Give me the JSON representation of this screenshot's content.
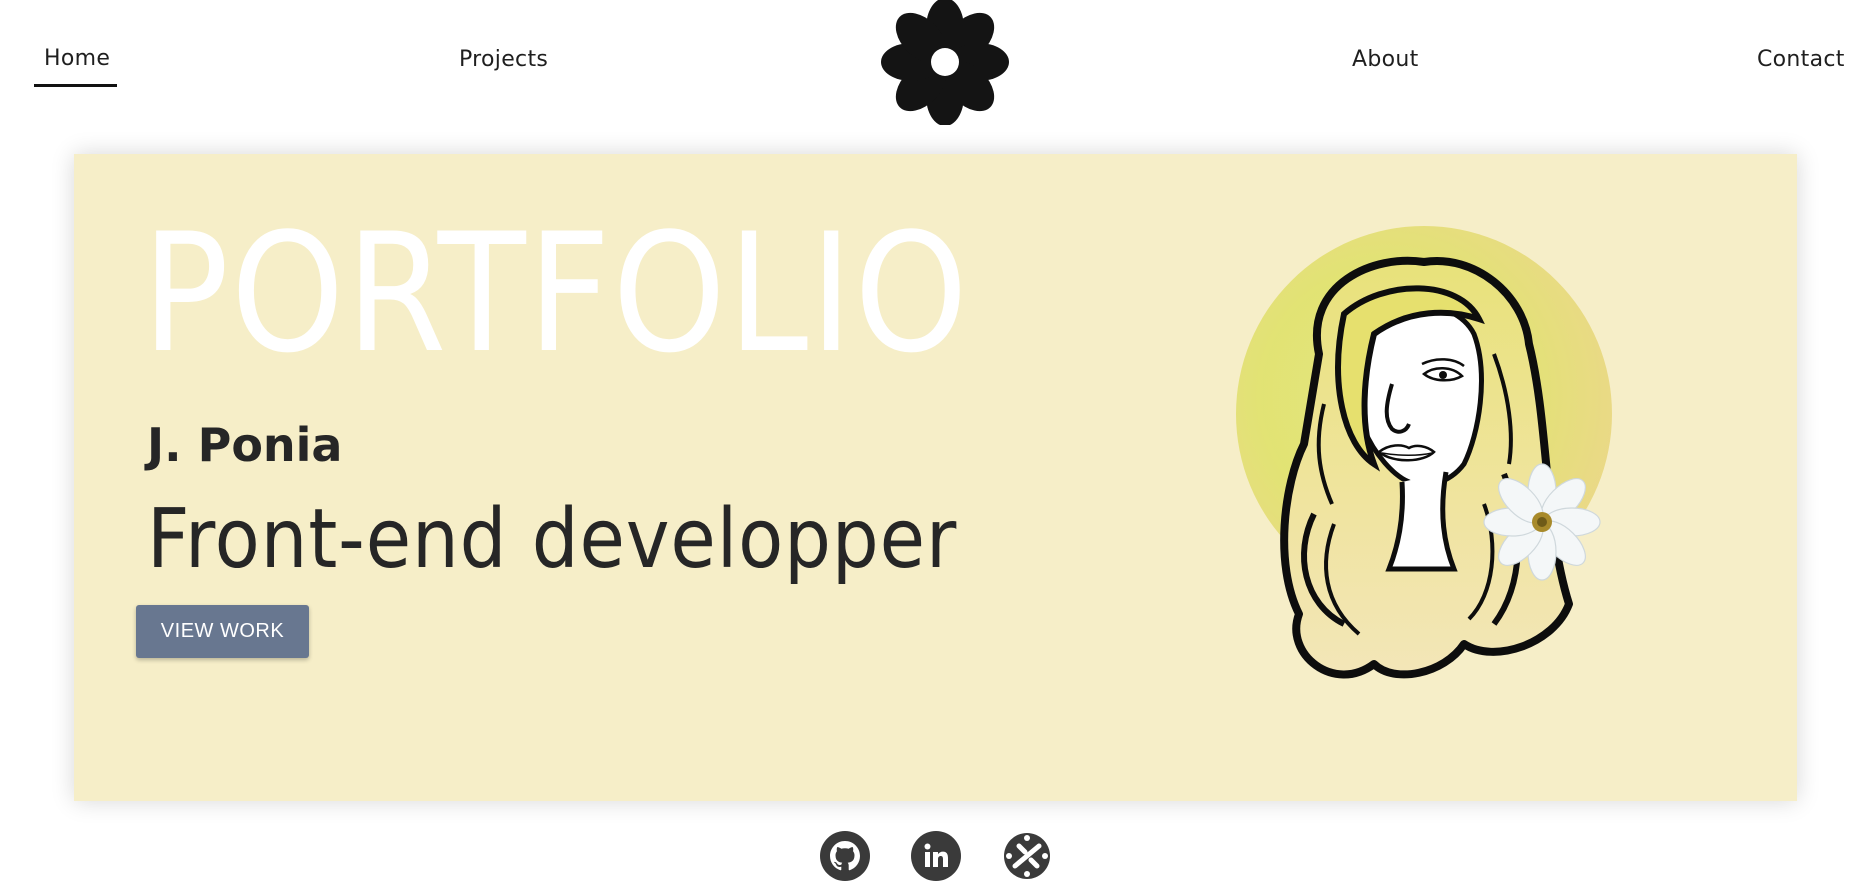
{
  "nav": {
    "items": [
      {
        "label": "Home",
        "active": true
      },
      {
        "label": "Projects"
      },
      {
        "label": "About"
      },
      {
        "label": "Contact"
      }
    ],
    "logo_icon": "flower-icon"
  },
  "hero": {
    "title": "PORTFOLIO",
    "name": "J. Ponia",
    "role": "Front-end developper",
    "button_label": "VIEW WORK",
    "portrait_icon": "portrait-illustration"
  },
  "social": {
    "icons": [
      "github-icon",
      "linkedin-icon",
      "zeplin-icon"
    ]
  },
  "colors": {
    "hero_bg": "#f6eec8",
    "button_bg": "#687790",
    "title_color": "#ffffff",
    "text_dark": "#262626",
    "icon_dark": "#3a3a3a"
  }
}
